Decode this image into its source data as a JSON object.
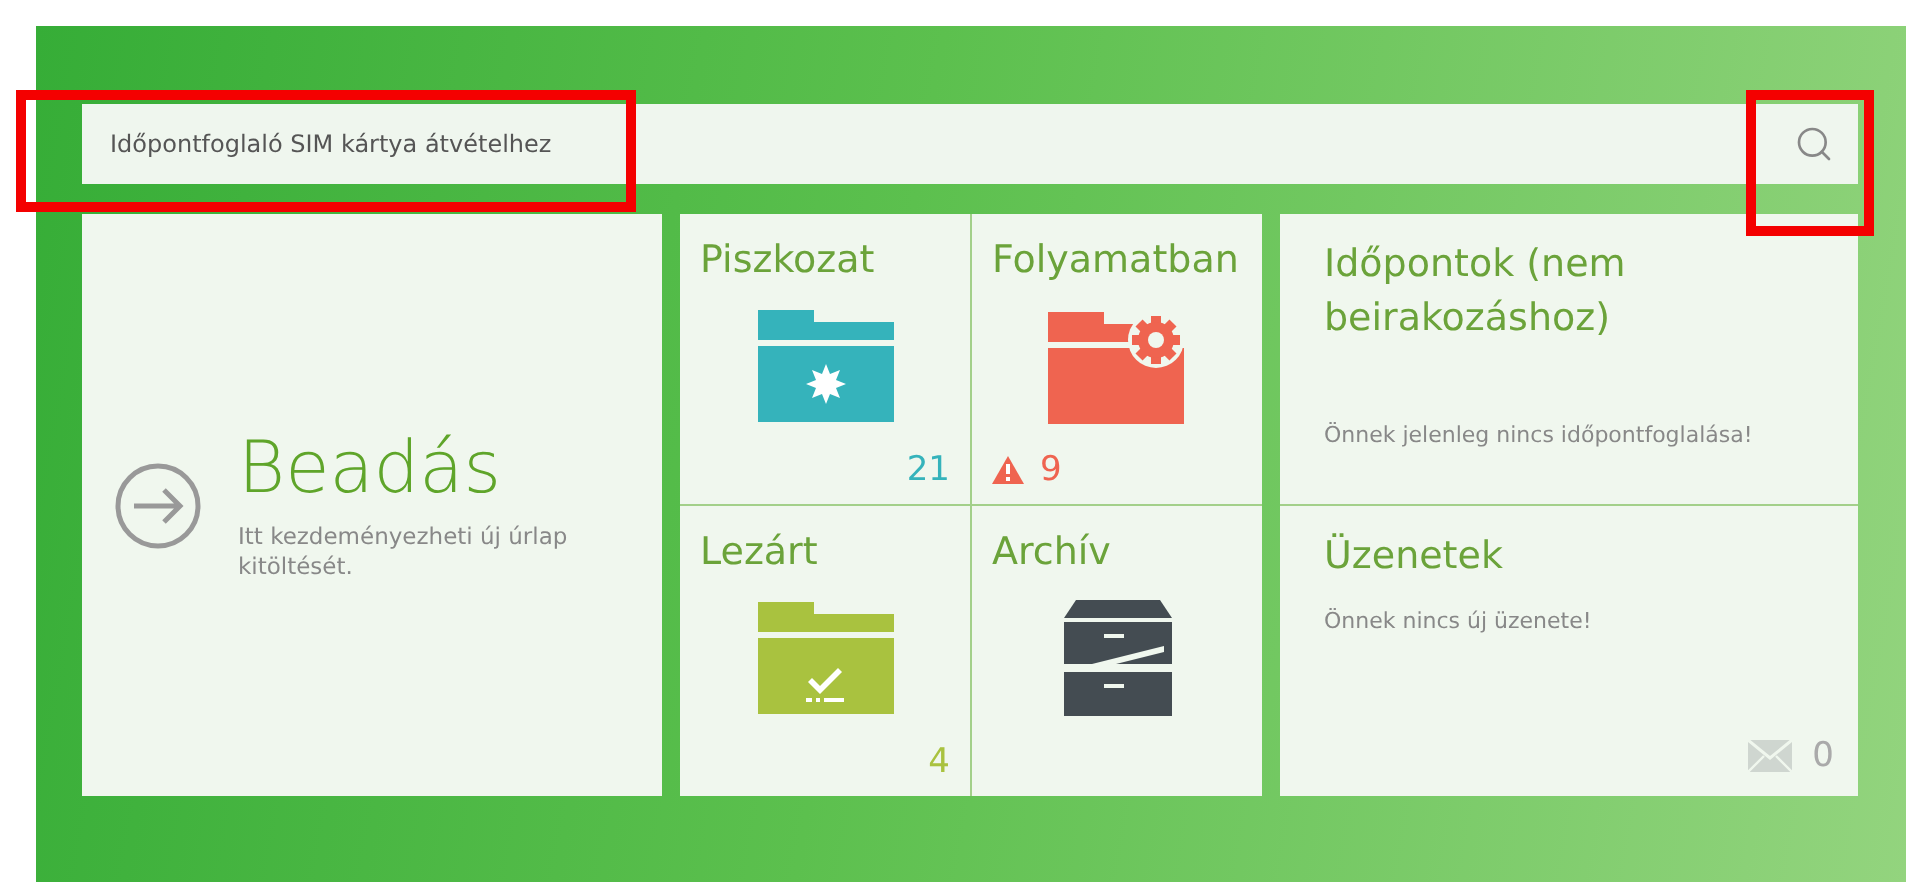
{
  "search": {
    "value": "Időpontfoglaló SIM kártya átvételhez",
    "highlighted": true
  },
  "search_button": {
    "highlighted": true
  },
  "submit_tile": {
    "title": "Beadás",
    "description": "Itt kezdeményezheti új úrlap kitöltését."
  },
  "folders": [
    {
      "kind": "draft",
      "title": "Piszkozat",
      "count": "21",
      "color": "#35b3bb",
      "warning": false
    },
    {
      "kind": "progress",
      "title": "Folyamatban",
      "count": "9",
      "color": "#ef6450",
      "warning": true
    },
    {
      "kind": "closed",
      "title": "Lezárt",
      "count": "4",
      "color": "#a9c23f",
      "warning": false
    },
    {
      "kind": "archive",
      "title": "Archív",
      "color": "#444c52",
      "warning": false
    }
  ],
  "info_tiles": [
    {
      "kind": "appointments",
      "title": "Időpontok (nem beirakozáshoz)",
      "message": "Önnek jelenleg nincs időpontfoglalása!"
    },
    {
      "kind": "messages",
      "title": "Üzenetek",
      "message": "Önnek nincs új üzenete!",
      "count": "0"
    }
  ]
}
